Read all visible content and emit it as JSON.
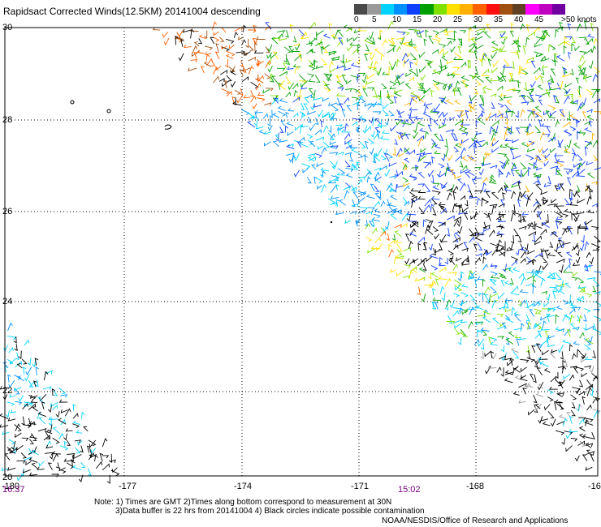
{
  "title": "Rapidsact Corrected Winds(12.5KM) 20141004 descending",
  "legend": {
    "colors": [
      "#4a4a4a",
      "#999999",
      "#00d2ff",
      "#0090ff",
      "#1040ff",
      "#00a000",
      "#80e000",
      "#ffe000",
      "#ffb000",
      "#ff6000",
      "#ff1010",
      "#a05010",
      "#604020",
      "#ff00ff",
      "#c000c0",
      "#7000a0"
    ],
    "labels": [
      "0",
      "5",
      "10",
      "15",
      "20",
      "25",
      "30",
      "35",
      "40",
      "45",
      ">50 knots"
    ]
  },
  "map": {
    "lat_labels": [
      "30",
      "28",
      "26",
      "24",
      "22",
      "20"
    ],
    "lon_labels": [
      "-180",
      "-177",
      "-174",
      "-171",
      "-168",
      "-16"
    ],
    "time_labels": [
      "16:37",
      "15:02"
    ]
  },
  "notes": [
    "Note: 1) Times are GMT 2)Times along bottom correspond to measurement at 30N",
    "3)Data buffer is 22 hrs from 20141004 4) Black circles indicate possible contamination"
  ],
  "credit": "NOAA/NESDIS/Office of Research and Applications"
}
